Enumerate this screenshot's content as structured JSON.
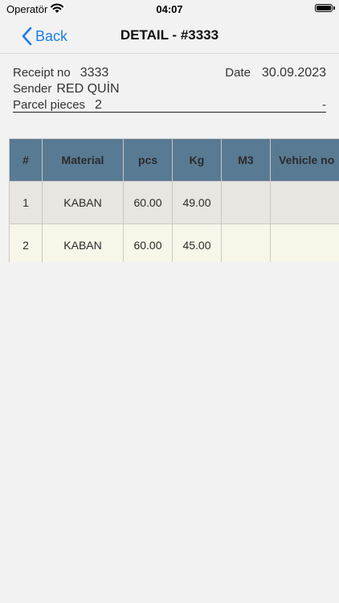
{
  "status_bar": {
    "carrier": "Operatör",
    "time": "04:07"
  },
  "nav": {
    "back_label": "Back",
    "title": "DETAIL - #3333"
  },
  "info": {
    "receipt_label": "Receipt no",
    "receipt_value": "3333",
    "date_label": "Date",
    "date_value": "30.09.2023",
    "sender_label": "Sender",
    "sender_value": "RED QUİN",
    "pieces_label": "Parcel pieces",
    "pieces_value": "2",
    "trailing": "-"
  },
  "table": {
    "headers": [
      "#",
      "Material",
      "pcs",
      "Kg",
      "M3",
      "Vehicle no"
    ],
    "rows": [
      [
        "1",
        "KABAN",
        "60.00",
        "49.00",
        "",
        ""
      ],
      [
        "2",
        "KABAN",
        "60.00",
        "45.00",
        "",
        ""
      ]
    ]
  },
  "colors": {
    "accent": "#1a7cf2",
    "header_bg": "#597a93",
    "row_odd": "#e8e6e0",
    "row_even": "#f8f6e8"
  }
}
